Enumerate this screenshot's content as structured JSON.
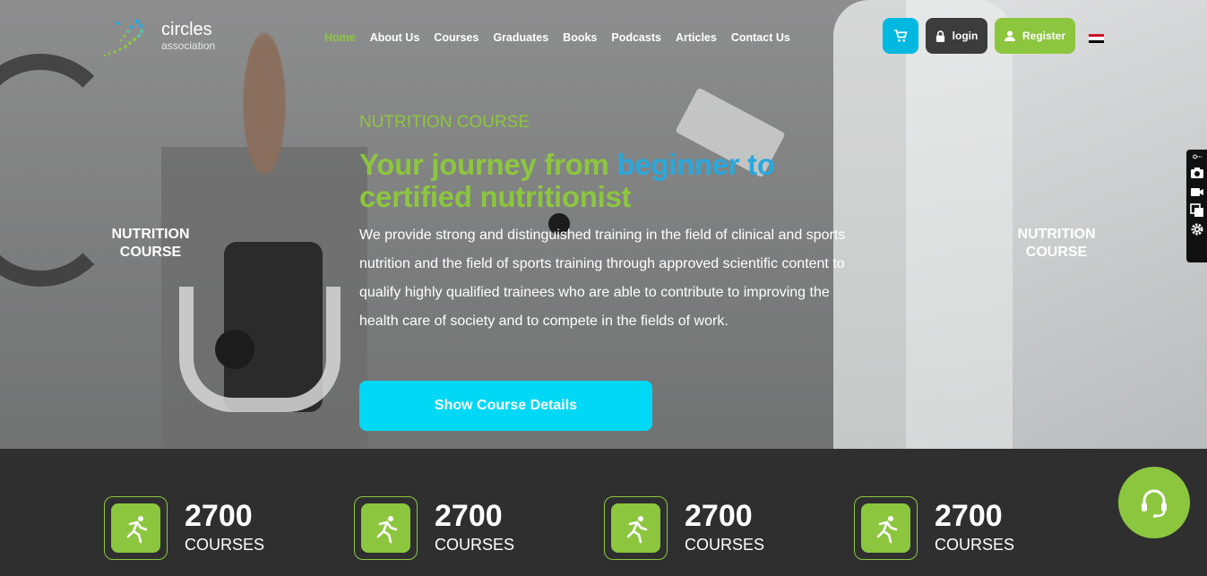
{
  "brand": {
    "line1": "circles",
    "line2": "association"
  },
  "nav": [
    {
      "label": "Home"
    },
    {
      "label": "About Us"
    },
    {
      "label": "Courses"
    },
    {
      "label": "Graduates"
    },
    {
      "label": "Books"
    },
    {
      "label": "Podcasts"
    },
    {
      "label": "Articles"
    },
    {
      "label": "Contact Us"
    }
  ],
  "header": {
    "login_label": "login",
    "register_label": "Register",
    "cart_icon": "cart-icon",
    "language": "egypt-flag"
  },
  "hero": {
    "side_left": "NUTRITION COURSE",
    "side_right": "NUTRITION COURSE",
    "eyebrow": "NUTRITION COURSE",
    "headline_part1": "Your journey from ",
    "headline_part2": "beginner to",
    "headline_part3": "certified nutritionist",
    "description": "We provide strong and distinguished training in the field of clinical and sports nutrition and the field of sports training through approved scientific content to qualify highly qualified trainees who are able to contribute to improving the health care of society and to compete in the fields of work.",
    "cta_label": "Show Course Details"
  },
  "stats": [
    {
      "value": "2700",
      "label": "COURSES"
    },
    {
      "value": "2700",
      "label": "COURSES"
    },
    {
      "value": "2700",
      "label": "COURSES"
    },
    {
      "value": "2700",
      "label": "COURSES"
    }
  ],
  "colors": {
    "green": "#8cc63f",
    "cyan": "#00d8f5",
    "blue": "#2aa8dc",
    "dark": "#2f2f2f"
  }
}
